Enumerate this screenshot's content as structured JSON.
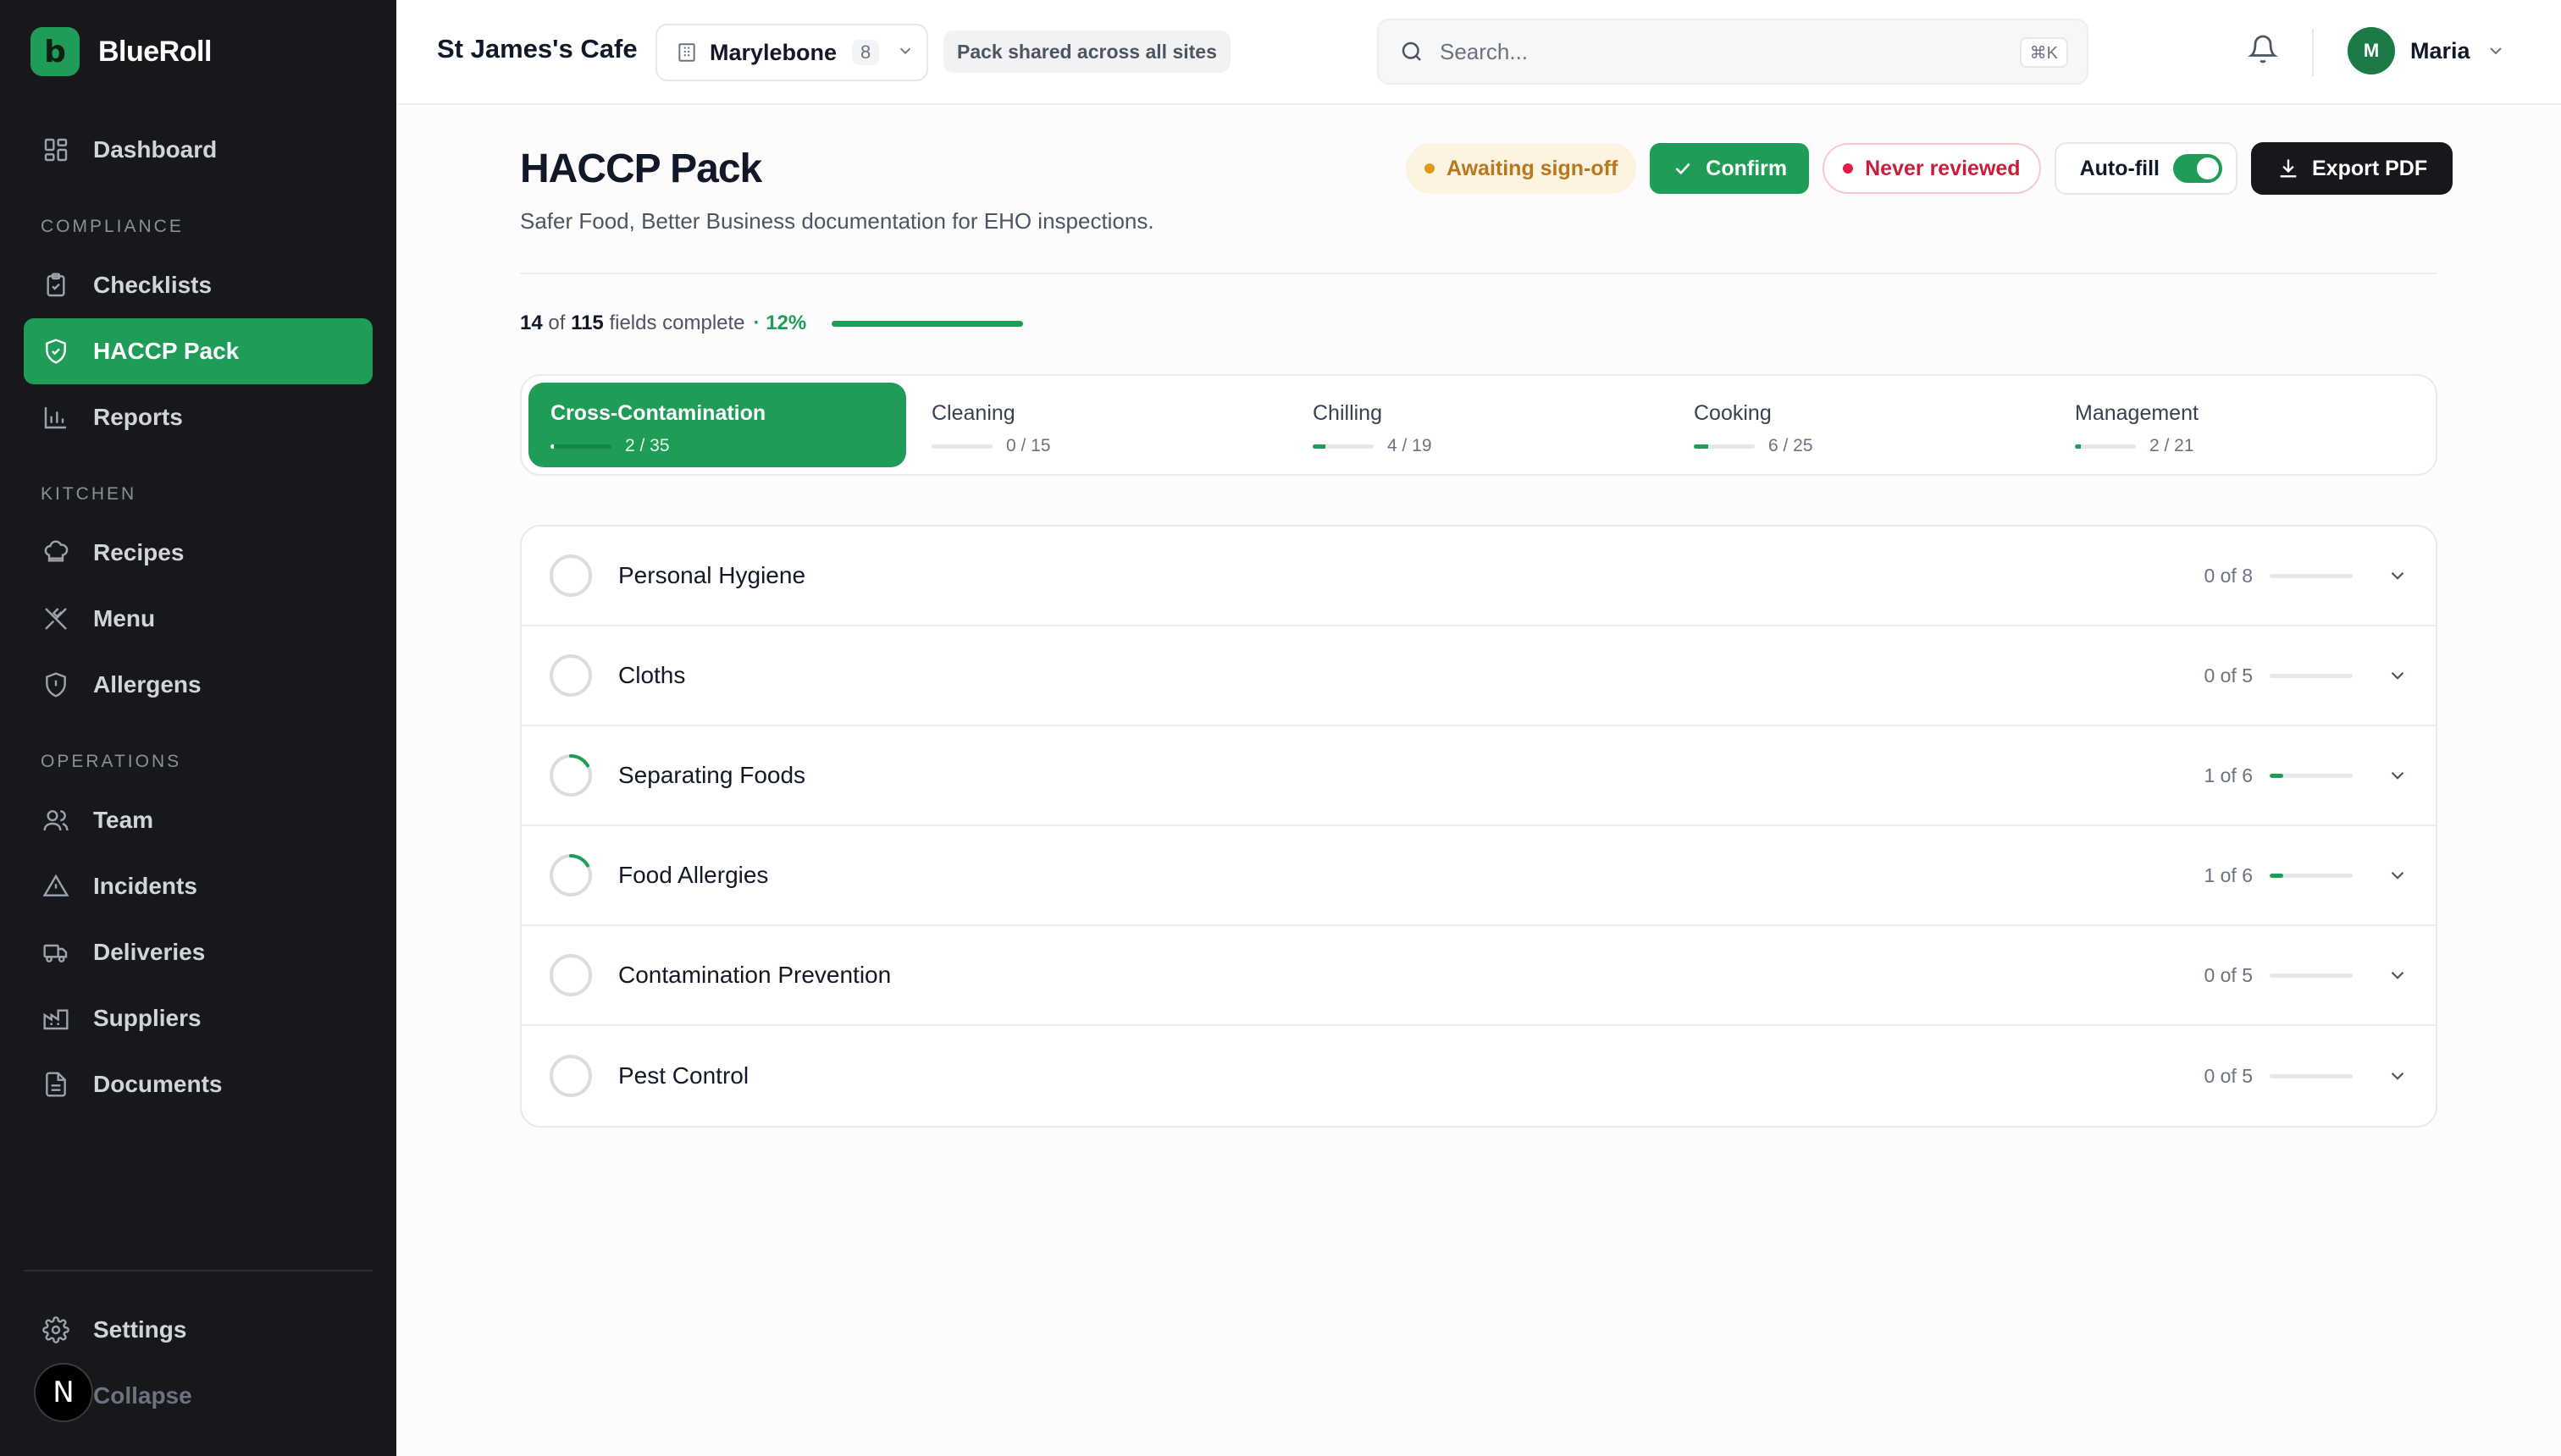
{
  "brand": {
    "logo_letter": "b",
    "name": "BlueRoll"
  },
  "sidebar": {
    "top": {
      "label": "Dashboard",
      "icon": "dashboard-icon"
    },
    "sections": [
      {
        "heading": "COMPLIANCE",
        "items": [
          {
            "label": "Checklists",
            "icon": "clipboard-check-icon",
            "active": false
          },
          {
            "label": "HACCP Pack",
            "icon": "shield-check-icon",
            "active": true
          },
          {
            "label": "Reports",
            "icon": "bar-chart-icon",
            "active": false
          }
        ]
      },
      {
        "heading": "KITCHEN",
        "items": [
          {
            "label": "Recipes",
            "icon": "chef-hat-icon",
            "active": false
          },
          {
            "label": "Menu",
            "icon": "utensils-crossed-icon",
            "active": false
          },
          {
            "label": "Allergens",
            "icon": "shield-alert-icon",
            "active": false
          }
        ]
      },
      {
        "heading": "OPERATIONS",
        "items": [
          {
            "label": "Team",
            "icon": "users-icon",
            "active": false
          },
          {
            "label": "Incidents",
            "icon": "warning-triangle-icon",
            "active": false
          },
          {
            "label": "Deliveries",
            "icon": "truck-icon",
            "active": false
          },
          {
            "label": "Suppliers",
            "icon": "factory-icon",
            "active": false
          },
          {
            "label": "Documents",
            "icon": "file-text-icon",
            "active": false
          }
        ]
      }
    ],
    "bottom": {
      "settings_label": "Settings",
      "collapse_label": "Collapse",
      "badge_letter": "N"
    }
  },
  "header": {
    "cafe_name": "St James's Cafe",
    "site": {
      "name": "Marylebone",
      "count": "8"
    },
    "pack_chip": "Pack shared across all sites",
    "search": {
      "placeholder": "Search...",
      "shortcut": "⌘K"
    },
    "user": {
      "initial": "M",
      "name": "Maria"
    }
  },
  "page": {
    "title": "HACCP Pack",
    "subtitle": "Safer Food, Better Business documentation for EHO inspections.",
    "status_awaiting": "Awaiting sign-off",
    "confirm_label": "Confirm",
    "status_review": "Never reviewed",
    "autofill_label": "Auto-fill",
    "autofill_on": true,
    "export_label": "Export PDF"
  },
  "progress": {
    "completed": "14",
    "of_word": "of",
    "total": "115",
    "suffix": "fields complete",
    "percent_label": "· 12%",
    "fraction": 0.12
  },
  "categories": [
    {
      "label": "Cross-Contamination",
      "count": "2 / 35",
      "done": 2,
      "total": 35,
      "active": true
    },
    {
      "label": "Cleaning",
      "count": "0 / 15",
      "done": 0,
      "total": 15,
      "active": false
    },
    {
      "label": "Chilling",
      "count": "4 / 19",
      "done": 4,
      "total": 19,
      "active": false
    },
    {
      "label": "Cooking",
      "count": "6 / 25",
      "done": 6,
      "total": 25,
      "active": false
    },
    {
      "label": "Management",
      "count": "2 / 21",
      "done": 2,
      "total": 21,
      "active": false
    }
  ],
  "sections": [
    {
      "title": "Personal Hygiene",
      "count": "0 of 8",
      "done": 0,
      "total": 8
    },
    {
      "title": "Cloths",
      "count": "0 of 5",
      "done": 0,
      "total": 5
    },
    {
      "title": "Separating Foods",
      "count": "1 of 6",
      "done": 1,
      "total": 6
    },
    {
      "title": "Food Allergies",
      "count": "1 of 6",
      "done": 1,
      "total": 6
    },
    {
      "title": "Contamination Prevention",
      "count": "0 of 5",
      "done": 0,
      "total": 5
    },
    {
      "title": "Pest Control",
      "count": "0 of 5",
      "done": 0,
      "total": 5
    }
  ],
  "colors": {
    "accent": "#1f9d58",
    "sidebar_bg": "#17181c",
    "warning": "#b7791f",
    "danger": "#c81e3a"
  }
}
